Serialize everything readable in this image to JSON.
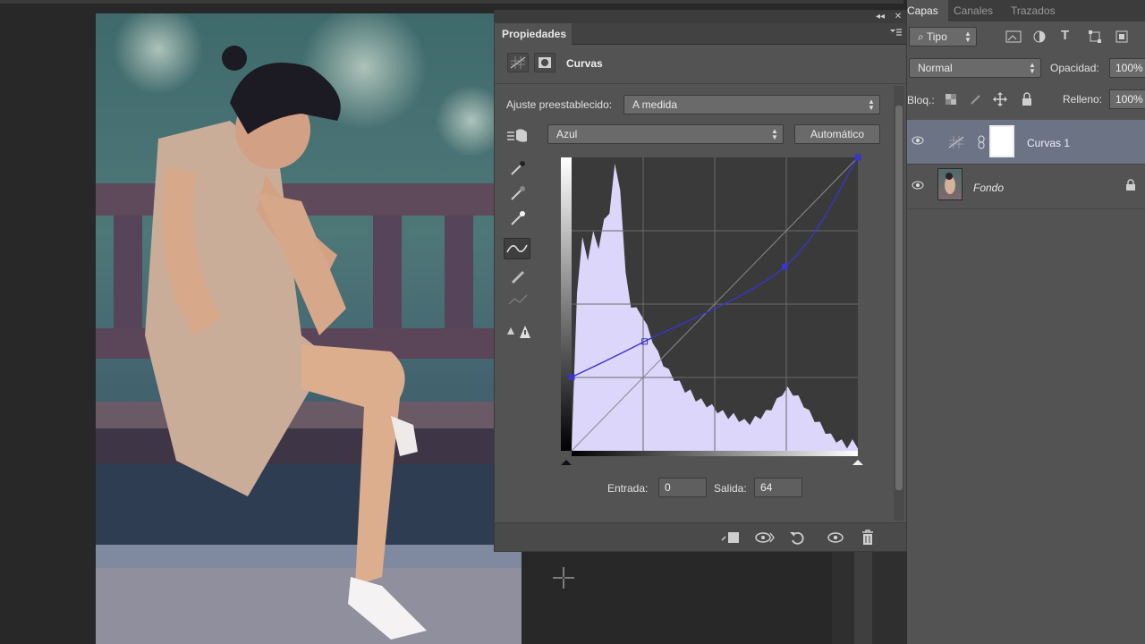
{
  "colors": {
    "panel": "#535353",
    "histogram": "#dcd6fb",
    "curve": "#3a34c9",
    "selected_layer": "#6b7385"
  },
  "properties": {
    "tab_label": "Propiedades",
    "icons": [
      "curves-adjustment-icon",
      "mask-icon",
      "panel-menu-icon",
      "collapse-icon",
      "close-icon"
    ],
    "title": "Curvas",
    "preset_label": "Ajuste preestablecido:",
    "preset_value": "A medida",
    "channel_value": "Azul",
    "auto_button": "Automático",
    "input_label": "Entrada:",
    "input_value": "0",
    "output_label": "Salida:",
    "output_value": "64",
    "tools": [
      "on-image-adjust-icon",
      "black-eyedropper-icon",
      "gray-eyedropper-icon",
      "white-eyedropper-icon",
      "curve-points-icon",
      "pencil-icon",
      "smooth-icon",
      "clipping-warning-icon"
    ],
    "bottom_icons": [
      "clip-to-layer-icon",
      "view-previous-icon",
      "reset-icon",
      "visibility-icon",
      "delete-icon"
    ]
  },
  "curve": {
    "channel": "Azul",
    "points": [
      [
        0,
        64
      ],
      [
        65,
        95
      ],
      [
        190,
        160
      ],
      [
        255,
        255
      ]
    ]
  },
  "layers_panel": {
    "tabs": [
      "Capas",
      "Canales",
      "Trazados"
    ],
    "filter_label": "Tipo",
    "blend_mode": "Normal",
    "opacity_label": "Opacidad:",
    "opacity_value": "100%",
    "lock_label": "Bloq.:",
    "fill_label": "Relleno:",
    "fill_value": "100%",
    "layers": [
      {
        "name": "Curvas 1",
        "selected": true,
        "icon": "curves-adjustment-icon"
      },
      {
        "name": "Fondo",
        "selected": false,
        "locked": true
      }
    ]
  }
}
